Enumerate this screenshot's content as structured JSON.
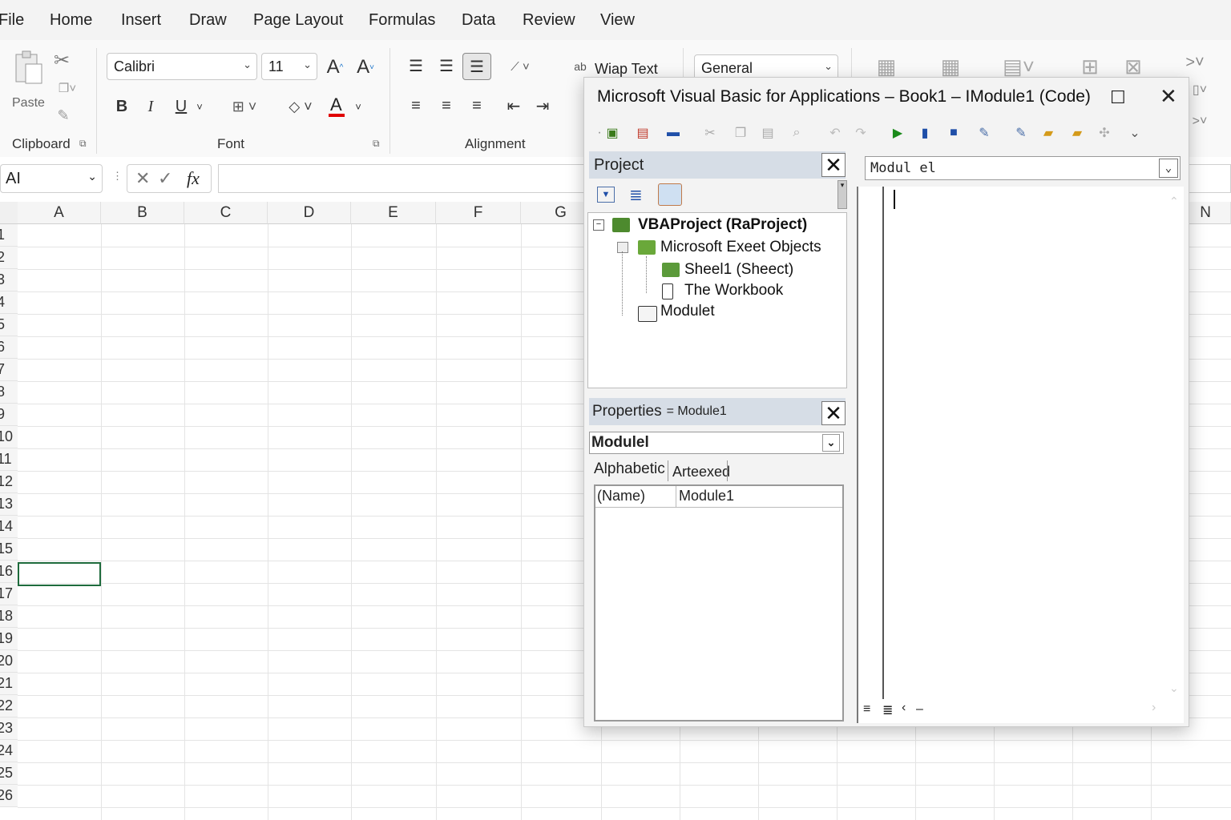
{
  "menu": [
    "File",
    "Home",
    "Insert",
    "Draw",
    "Page Layout",
    "Formulas",
    "Data",
    "Review",
    "View"
  ],
  "ribbon": {
    "clipboard": {
      "paste_label": "Paste",
      "group_label": "Clipboard"
    },
    "font": {
      "name": "Calibri",
      "size": "11",
      "group_label": "Font",
      "bold": "B",
      "italic": "I",
      "underline": "U",
      "grow": "A",
      "shrink": "A",
      "color_letter": "A"
    },
    "alignment": {
      "group_label": "Alignment",
      "wrap_text": "Wiap Text"
    },
    "number": {
      "format": "General"
    }
  },
  "formula_bar": {
    "name_box": "AI",
    "fx": "fx",
    "value": ""
  },
  "grid": {
    "columns": [
      "A",
      "B",
      "C",
      "D",
      "E",
      "F",
      "G",
      "N"
    ],
    "rows": [
      "1",
      "2",
      "3",
      "4",
      "5",
      "6",
      "7",
      "8",
      "9",
      "10",
      "11",
      "12",
      "13",
      "14",
      "15",
      "16",
      "17",
      "18",
      "19",
      "20",
      "21",
      "22",
      "23",
      "24",
      "25",
      "26"
    ],
    "selected_cell": "A16"
  },
  "vba": {
    "title": "Microsoft Visual Basic for Applications – Book1 – IModule1 (Code)",
    "project": {
      "header": "Project",
      "root": "VBAProject (RaProject)",
      "folder": "Microsoft Exeet Objects",
      "sheet": "Sheel1 (Sheect)",
      "workbook": "The Workbook",
      "module": "Modulet"
    },
    "properties": {
      "header": "Properties",
      "header_suffix": "= Module1",
      "object": "Modulel",
      "tab_alphabetic": "Alphabetic",
      "tab_categorized": "Arteexed",
      "prop_name": "(Name)",
      "prop_value": "Module1"
    },
    "code": {
      "object_combo": "Modul el"
    }
  },
  "colors": {
    "selection_border": "#1e6b3c",
    "pane_header": "#d6dde6",
    "font_color_bar": "#e00000"
  }
}
